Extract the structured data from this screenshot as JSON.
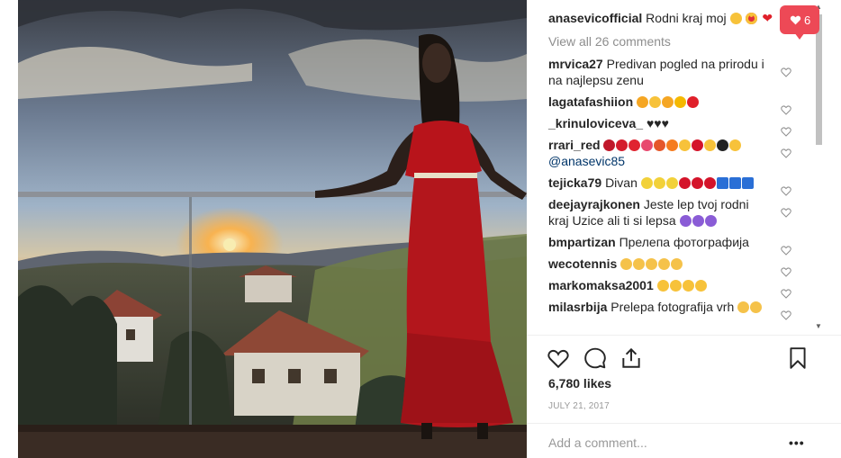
{
  "post": {
    "author": "anasevicofficial",
    "caption": "Rodni kraj moj",
    "caption_emojis": [
      "smiling-face-icon",
      "heart-eyes-icon",
      "red-heart-icon"
    ],
    "view_all_comments": "View all 26 comments",
    "likes": "6,780 likes",
    "date": "JULY 21, 2017",
    "add_comment_placeholder": "Add a comment...",
    "more_options": "•••"
  },
  "notification": {
    "count": "6",
    "color": "#ed4956"
  },
  "comments": [
    {
      "user": "mrvica27",
      "text": "Predivan pogled na prirodu i na najlepsu zenu",
      "emojis": []
    },
    {
      "user": "lagatafashiion",
      "text": "",
      "emojis": [
        "lion-face-icon",
        "sunglasses-face-icon",
        "lion-face-icon",
        "crown-icon",
        "heart-exclamation-icon"
      ]
    },
    {
      "user": "_krinuloviceva_",
      "text": "♥♥♥",
      "emojis": []
    },
    {
      "user": "rrari_red",
      "text": "",
      "emojis": [
        "dancer-icon",
        "rose-icon",
        "balloon-icon",
        "love-letter-icon",
        "collision-icon",
        "fire-icon",
        "savoring-face-icon",
        "kiss-mark-icon",
        "heart-eyes-icon",
        "black-heart-icon",
        "heart-eyes-icon"
      ],
      "mention": "@anasevic85"
    },
    {
      "user": "tejicka79",
      "text": "Divan",
      "emojis": [
        "sparkle-icon",
        "sparkle-icon",
        "sparkle-icon",
        "lips-icon",
        "lips-icon",
        "lips-icon",
        "top-arrow-icon",
        "top-arrow-icon",
        "top-arrow-icon"
      ]
    },
    {
      "user": "deejayrajkonen",
      "text": "Jeste lep tvoj rodni kraj Uzice ali ti si lepsa",
      "emojis": [
        "purple-heart-icon",
        "purple-heart-icon",
        "purple-heart-icon"
      ]
    },
    {
      "user": "bmpartizan",
      "text": "Прелепа фотографија",
      "emojis": []
    },
    {
      "user": "wecotennis",
      "text": "",
      "emojis": [
        "ok-hand-icon",
        "ok-hand-icon",
        "ok-hand-icon",
        "ok-hand-icon",
        "ok-hand-icon"
      ]
    },
    {
      "user": "markomaksa2001",
      "text": "",
      "emojis": [
        "heart-eyes-icon",
        "savoring-face-icon",
        "heart-eyes-icon",
        "savoring-face-icon"
      ]
    },
    {
      "user": "milasrbija",
      "text": "Prelepa fotografija vrh",
      "emojis": [
        "thumbs-up-icon",
        "thumbs-up-icon"
      ]
    }
  ],
  "colors": {
    "accent_red": "#ed4956",
    "muted_text": "#8e8e8e",
    "mention": "#003569"
  }
}
